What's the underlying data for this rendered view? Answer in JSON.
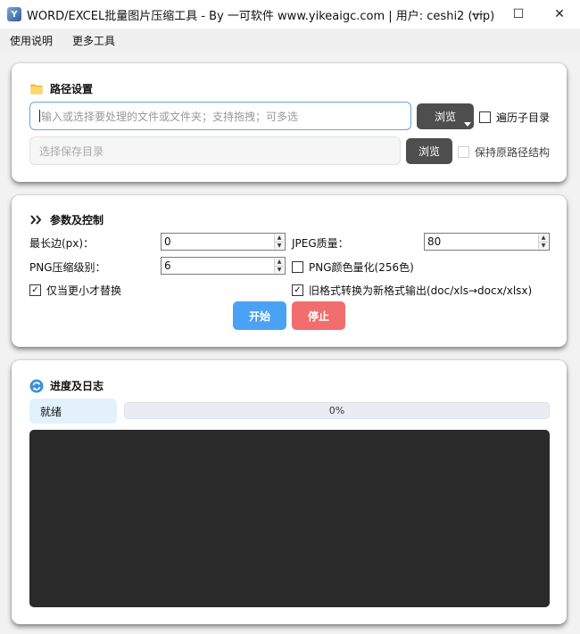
{
  "window": {
    "title": "WORD/EXCEL批量图片压缩工具 - By 一可软件 www.yikeaigc.com | 用户: ceshi2 (vip)",
    "icon_letter": "Y",
    "controls": {
      "minimize": "—",
      "maximize": "☐",
      "close": "✕"
    }
  },
  "menu": {
    "items": [
      "使用说明",
      "更多工具"
    ]
  },
  "path_section": {
    "title": "路径设置",
    "icon": "folder-icon",
    "source_input": {
      "placeholder": "输入或选择要处理的文件或文件夹；支持拖拽；可多选",
      "value": ""
    },
    "browse_label": "浏览",
    "recursive": {
      "label": "遍历子目录",
      "checked": false
    },
    "save_input": {
      "placeholder": "选择保存目录",
      "value": ""
    },
    "save_browse_label": "浏览",
    "keep_structure": {
      "label": "保持原路径结构",
      "checked": false,
      "enabled": false
    }
  },
  "params_section": {
    "title": "参数及控制",
    "icon": "double-chevron-icon",
    "max_side": {
      "label": "最长边(px)：",
      "value": "0"
    },
    "jpeg_quality": {
      "label": "JPEG质量：",
      "value": "80"
    },
    "png_level": {
      "label": "PNG压缩级别：",
      "value": "6"
    },
    "png_quantize": {
      "label": "PNG颜色量化(256色)",
      "checked": false
    },
    "replace_smaller": {
      "label": "仅当更小才替换",
      "checked": true
    },
    "convert_legacy": {
      "label": "旧格式转换为新格式输出(doc/xls→docx/xlsx)",
      "checked": true
    },
    "start_label": "开始",
    "stop_label": "停止"
  },
  "progress_section": {
    "title": "进度及日志",
    "icon": "refresh-icon",
    "status": "就绪",
    "progress_fraction": 0,
    "progress_text": "0%",
    "log_text": ""
  },
  "colors": {
    "accent_blue": "#4ba2f4",
    "stop_red": "#f26e6e",
    "dark_button": "#4e4e4e",
    "log_bg": "#2a2a2a"
  }
}
